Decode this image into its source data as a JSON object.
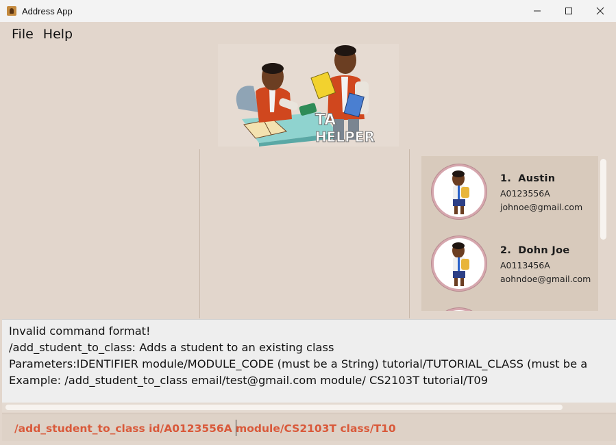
{
  "window": {
    "title": "Address App",
    "controls": {
      "minimize": "─",
      "maximize": "☐",
      "close": "✕"
    }
  },
  "menu": {
    "file": "File",
    "help": "Help"
  },
  "logo": {
    "text_line1": "TA",
    "text_line2": "HELPER"
  },
  "persons": [
    {
      "index": "1.",
      "name": "Austin",
      "student_id": "A0123556A",
      "email": "johnoe@gmail.com"
    },
    {
      "index": "2.",
      "name": "Dohn Joe",
      "student_id": "A0113456A",
      "email": "aohndoe@gmail.com"
    }
  ],
  "result": {
    "line1": "Invalid command format!",
    "line2": "/add_student_to_class: Adds a student to an existing class",
    "line3": "Parameters:IDENTIFIER module/MODULE_CODE (must be a String) tutorial/TUTORIAL_CLASS (must be a",
    "line4": "Example: /add_student_to_class email/test@gmail.com module/ CS2103T tutorial/T09"
  },
  "command": {
    "value": "/add_student_to_class id/A0123556A module/CS2103T class/T10"
  },
  "colors": {
    "background": "#e2d6cc",
    "command_text": "#d9593a",
    "card_bg": "#d8cabc"
  }
}
